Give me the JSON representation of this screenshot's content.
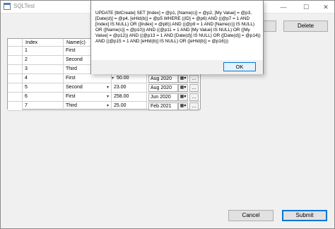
{
  "window": {
    "title": "SQLTest",
    "minimize_glyph": "—",
    "maximize_glyph": "☐",
    "close_glyph": "✕",
    "icon": "app-window-icon"
  },
  "toolbar": {
    "delete_label": "Delete"
  },
  "grid": {
    "headers": [
      "Index",
      "Name(c)"
    ],
    "rows": [
      {
        "index": "1",
        "name": "First",
        "value": "",
        "date": ""
      },
      {
        "index": "2",
        "name": "Second",
        "value": "",
        "date": ""
      },
      {
        "index": "3",
        "name": "Third",
        "value": "",
        "date": ""
      },
      {
        "index": "4",
        "name": "First",
        "value": "50.00",
        "date": "Aug 2020"
      },
      {
        "index": "5",
        "name": "Second",
        "value": "23.00",
        "date": "Aug 2020"
      },
      {
        "index": "6",
        "name": "First",
        "value": "258.00",
        "date": "Jun 2020"
      },
      {
        "index": "7",
        "name": "Third",
        "value": "25.00",
        "date": "Feb 2021"
      }
    ],
    "dots_label": "...",
    "cal_glyph": "▦▾"
  },
  "dialog": {
    "message": "UPDATE [tblCreate] SET [Index] = @p1, [Name(c)] = @p2, [My Value] = @p3, [Date(d)] = @p4, [eHId(b)] = @p5 WHERE ((ID] = @p6) AND ((@p7 = 1 AND [Index] IS NULL) OR ([Index] = @p8)) AND ((@p9 = 1 AND [Name(c)] IS NULL) OR ([Name(c)] = @p10)) AND ((@p11 = 1 AND [My Value] IS NULL) OR ([My Value] = @p12)) AND ((@p13 = 1 AND [Date(d)] IS NULL) OR ([Date(d)] = @p14)) AND ((@p15 = 1 AND [eHId(b)] IS NULL) OR ([eHId(b)] = @p16)))",
    "ok_label": "OK"
  },
  "footer": {
    "cancel_label": "Cancel",
    "submit_label": "Submit"
  },
  "colors": {
    "accent": "#0078d7",
    "window_bg": "#f0f0f0"
  }
}
